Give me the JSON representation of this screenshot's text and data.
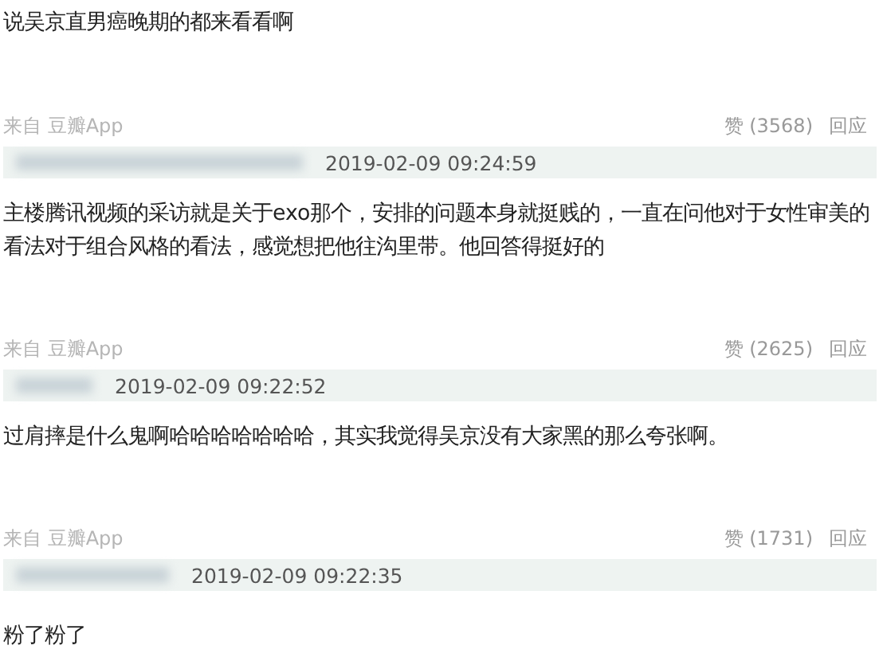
{
  "leading_text": "说吴京直男癌晚期的都来看看啊",
  "comments": [
    {
      "source": "来自 豆瓣App",
      "likes": "赞 (3568)",
      "reply": "回应",
      "timestamp": "2019-02-09 09:24:59",
      "body": "主楼腾讯视频的采访就是关于exo那个，安排的问题本身就挺贱的，一直在问他对于女性审美的看法对于组合风格的看法，感觉想把他往沟里带。他回答得挺好的"
    },
    {
      "source": "来自 豆瓣App",
      "likes": "赞 (2625)",
      "reply": "回应",
      "timestamp": "2019-02-09 09:22:52",
      "body": "过肩摔是什么鬼啊哈哈哈哈哈哈哈，其实我觉得吴京没有大家黑的那么夸张啊。"
    },
    {
      "source": "来自 豆瓣App",
      "likes": "赞 (1731)",
      "reply": "回应",
      "timestamp": "2019-02-09 09:22:35",
      "body": "粉了粉了"
    }
  ]
}
